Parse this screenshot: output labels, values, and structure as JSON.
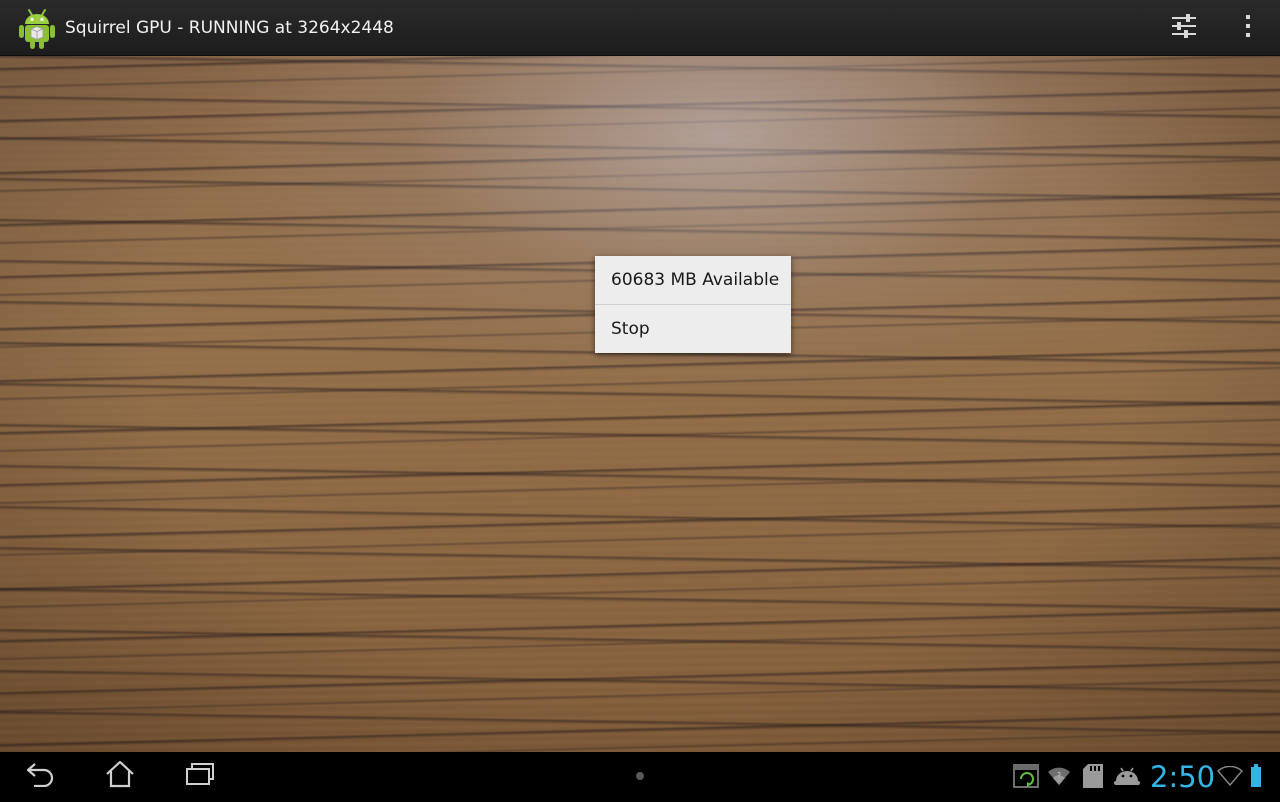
{
  "action_bar": {
    "title": "Squirrel GPU - RUNNING at 3264x2448",
    "app_icon": "android-robot-icon",
    "settings_icon": "sliders-icon",
    "overflow_icon": "overflow-menu-icon"
  },
  "popup_menu": {
    "items": [
      {
        "label": "60683 MB Available"
      },
      {
        "label": "Stop"
      }
    ]
  },
  "system_bar": {
    "nav": [
      "back-icon",
      "home-icon",
      "recent-apps-icon"
    ],
    "status_icons": [
      "screenshot-icon",
      "wifi-signal-icon",
      "sd-card-icon",
      "android-debug-icon"
    ],
    "clock": "2:50",
    "accent_color": "#33b5e5"
  }
}
